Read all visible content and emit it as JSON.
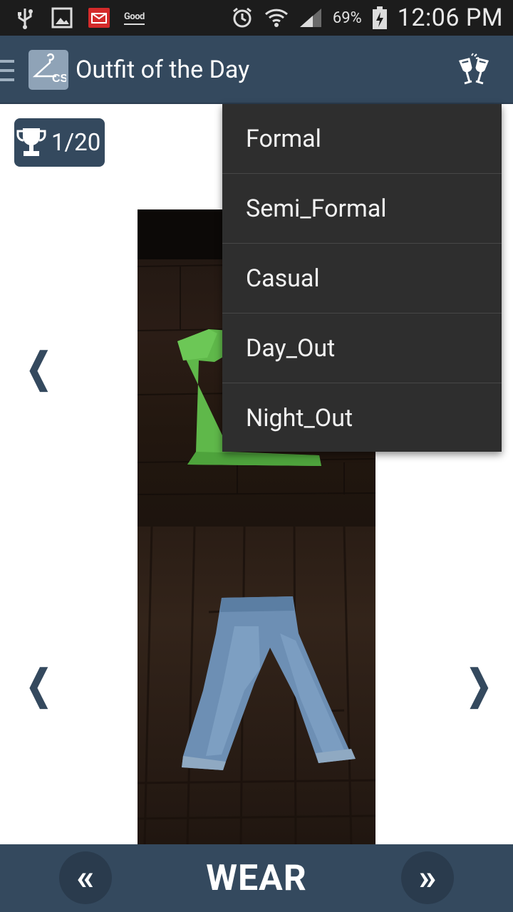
{
  "status_bar": {
    "good_label": "Good",
    "battery_percent": "69%",
    "time": "12:06 PM"
  },
  "app_bar": {
    "logo_text": "CS",
    "title": "Outfit of the Day"
  },
  "counter": {
    "text": "1/20"
  },
  "dropdown": {
    "items": [
      "Formal",
      "Semi_Formal",
      "Casual",
      "Day_Out",
      "Night_Out"
    ]
  },
  "arrows": {
    "left": "❮",
    "right": "❯"
  },
  "bottom_bar": {
    "prev": "«",
    "wear": "WEAR",
    "next": "»"
  },
  "colors": {
    "primary": "#34495e",
    "menu_bg": "#2e2e2e",
    "status_bar": "#1c1c1c"
  }
}
